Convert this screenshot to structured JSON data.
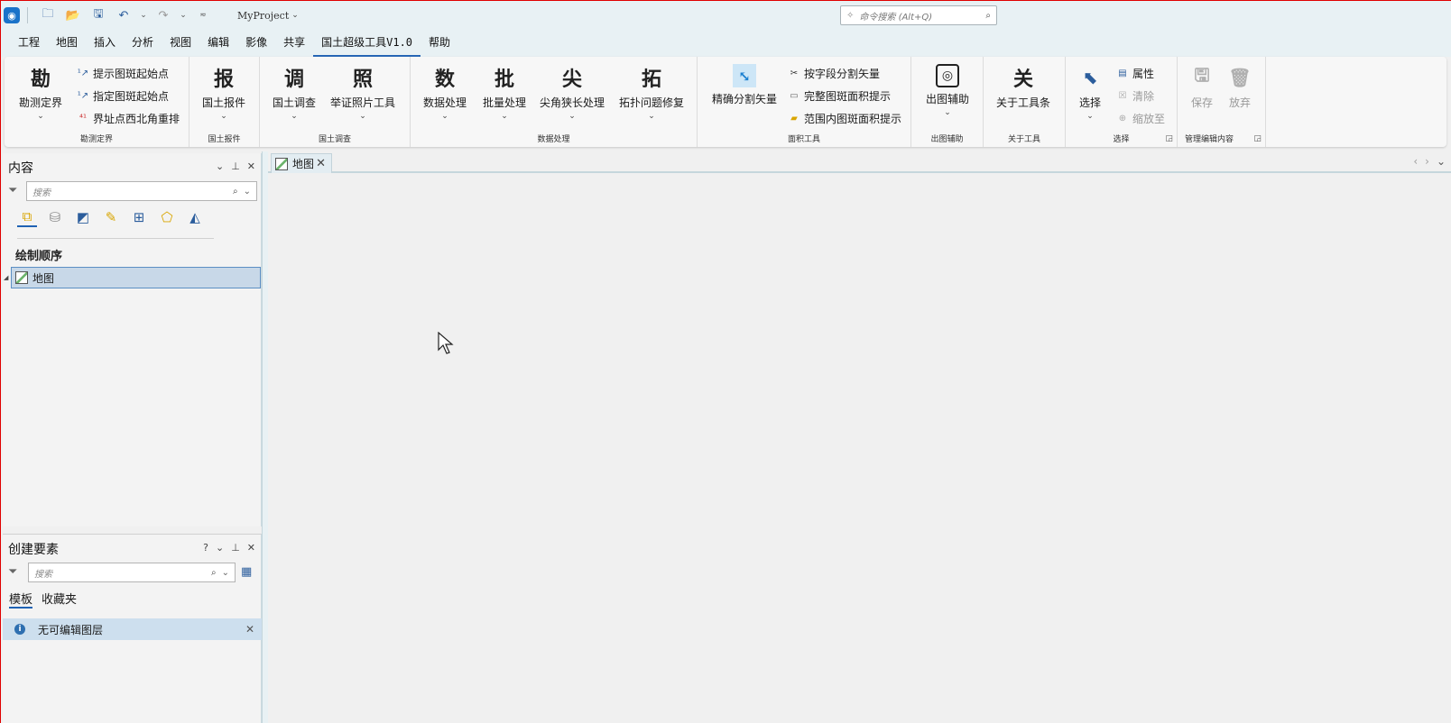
{
  "titlebar": {
    "project": "MyProject",
    "command_search_placeholder": "命令搜索 (Alt+Q)"
  },
  "menu": [
    "工程",
    "地图",
    "插入",
    "分析",
    "视图",
    "编辑",
    "影像",
    "共享",
    "国土超级工具V1.0",
    "帮助"
  ],
  "menu_active_index": 8,
  "ribbon": {
    "groups": {
      "kance": {
        "label": "勘测定界",
        "big_icon": "勘",
        "big_label": "勘测定界",
        "small": [
          "提示图斑起始点",
          "指定图斑起始点",
          "界址点西北角重排"
        ]
      },
      "baojian": {
        "label": "国土报件",
        "big_icon": "报",
        "big_label": "国土报件"
      },
      "diaocha": {
        "label": "国土调查",
        "b1_icon": "调",
        "b1_label": "国土调查",
        "b2_icon": "照",
        "b2_label": "举证照片工具"
      },
      "shuju": {
        "label": "数据处理",
        "b1_icon": "数",
        "b1_label": "数据处理",
        "b2_icon": "批",
        "b2_label": "批量处理",
        "b3_icon": "尖",
        "b3_label": "尖角狭长处理",
        "b4_icon": "拓",
        "b4_label": "拓扑问题修复"
      },
      "mianji": {
        "label": "面积工具",
        "big_label": "精确分割矢量",
        "small": [
          "按字段分割矢量",
          "完整图斑面积提示",
          "范围内图斑面积提示"
        ]
      },
      "chutu": {
        "label": "出图辅助",
        "big_label": "出图辅助"
      },
      "guanyu": {
        "label": "关于工具",
        "big_icon": "关",
        "big_label": "关于工具条"
      },
      "xuanze": {
        "label": "选择",
        "big_label": "选择",
        "small": [
          "属性",
          "清除",
          "缩放至"
        ]
      },
      "guanli": {
        "label": "管理编辑内容",
        "save": "保存",
        "discard": "放弃"
      }
    }
  },
  "contents": {
    "title": "内容",
    "search_placeholder": "搜索",
    "section": "绘制顺序",
    "layer": "地图"
  },
  "create_features": {
    "title": "创建要素",
    "search_placeholder": "搜索",
    "tabs": [
      "模板",
      "收藏夹"
    ],
    "info": "无可编辑图层"
  },
  "map_tab": "地图"
}
